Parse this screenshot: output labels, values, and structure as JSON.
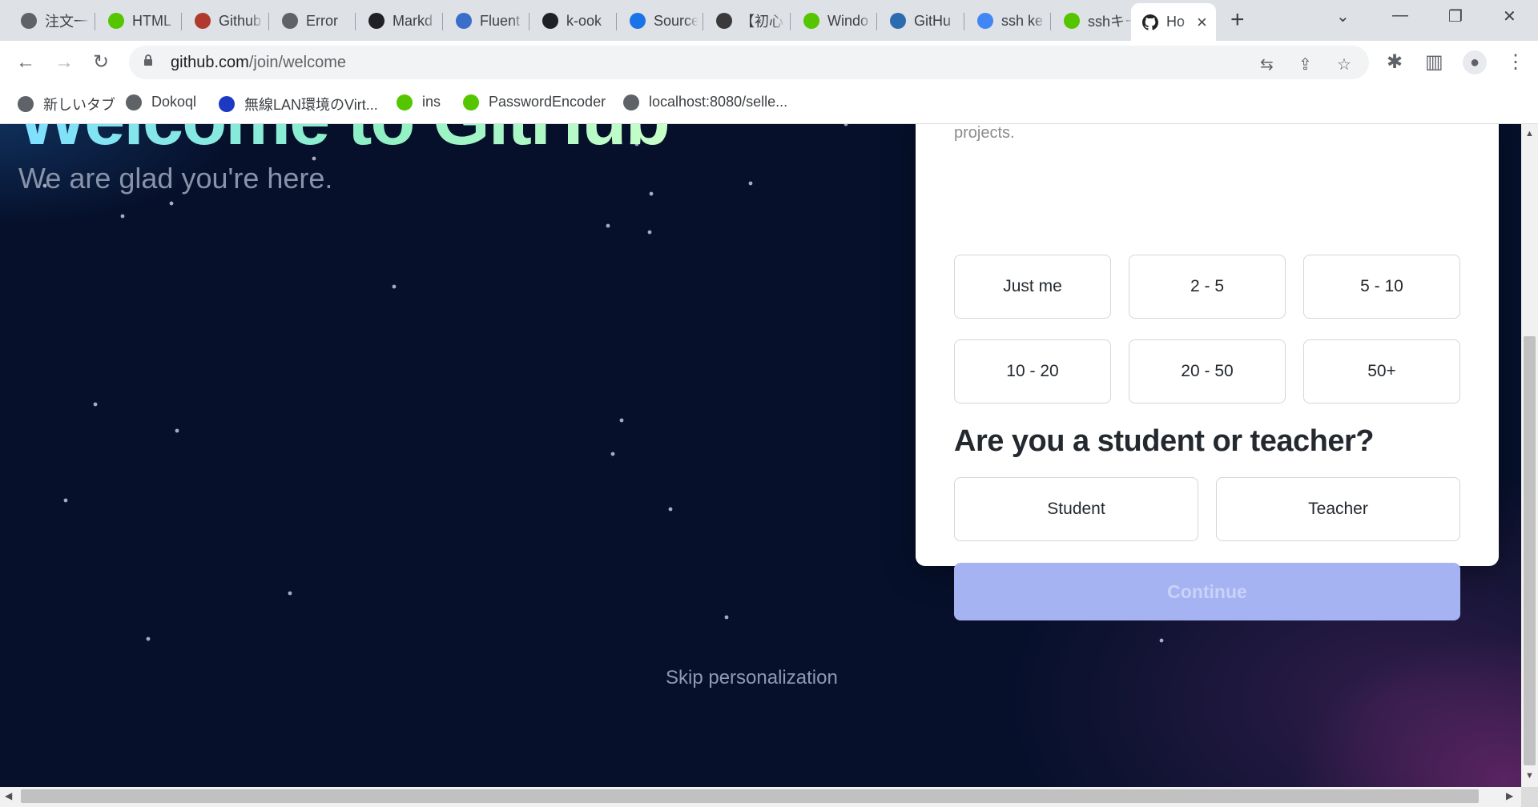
{
  "browser": {
    "tabs": [
      {
        "title": "注文一",
        "icon": "globe-icon",
        "color": "#5f6368"
      },
      {
        "title": "HTML",
        "icon": "qiita-icon",
        "color": "#55c500"
      },
      {
        "title": "Github",
        "icon": "avatar-icon",
        "color": "#b03a2e"
      },
      {
        "title": "Error",
        "icon": "globe-icon",
        "color": "#5f6368"
      },
      {
        "title": "Markd",
        "icon": "markdown-icon",
        "color": "#202124"
      },
      {
        "title": "Fluent",
        "icon": "document-icon",
        "color": "#3b6ec8"
      },
      {
        "title": "k-ook",
        "icon": "github-icon",
        "color": "#202124"
      },
      {
        "title": "Source",
        "icon": "map-pin-icon",
        "color": "#1a73e8"
      },
      {
        "title": "【初心",
        "icon": "thumbnail-icon",
        "color": "#3a3a3a"
      },
      {
        "title": "Windo",
        "icon": "qiita-icon",
        "color": "#55c500"
      },
      {
        "title": "GitHu",
        "icon": "shield-icon",
        "color": "#2b6cb0"
      },
      {
        "title": "ssh ke",
        "icon": "google-icon",
        "color": "#4285f4"
      },
      {
        "title": "sshキー",
        "icon": "qiita-icon",
        "color": "#55c500"
      }
    ],
    "active_tab": {
      "title": "Ho",
      "icon": "github-icon"
    },
    "url_host": "github.com",
    "url_path": "/join/welcome",
    "bookmarks": [
      {
        "label": "新しいタブ",
        "icon": "globe-icon",
        "color": "#5f6368"
      },
      {
        "label": "Dokoql",
        "icon": "globe-icon",
        "color": "#5f6368"
      },
      {
        "label": "無線LAN環境のVirt...",
        "icon": "yahoo-icon",
        "color": "#1d39c4"
      },
      {
        "label": "ins",
        "icon": "qiita-icon",
        "color": "#55c500"
      },
      {
        "label": "PasswordEncoder",
        "icon": "qiita-icon",
        "color": "#55c500"
      },
      {
        "label": "localhost:8080/selle...",
        "icon": "globe-icon",
        "color": "#5f6368"
      }
    ]
  },
  "hero": {
    "title": "Welcome to GitHub",
    "subtitle": "We are glad you're here."
  },
  "card": {
    "cut_text": "projects.",
    "team_size_options": [
      "Just me",
      "2 - 5",
      "5 - 10",
      "10 - 20",
      "20 - 50",
      "50+"
    ],
    "question": "Are you a student or teacher?",
    "role_options": [
      "Student",
      "Teacher"
    ],
    "continue_label": "Continue"
  },
  "skip_label": "Skip personalization",
  "colors": {
    "page_bg": "#06102b",
    "continue_disabled": "#a5b3f2",
    "heading": "#24292f"
  }
}
